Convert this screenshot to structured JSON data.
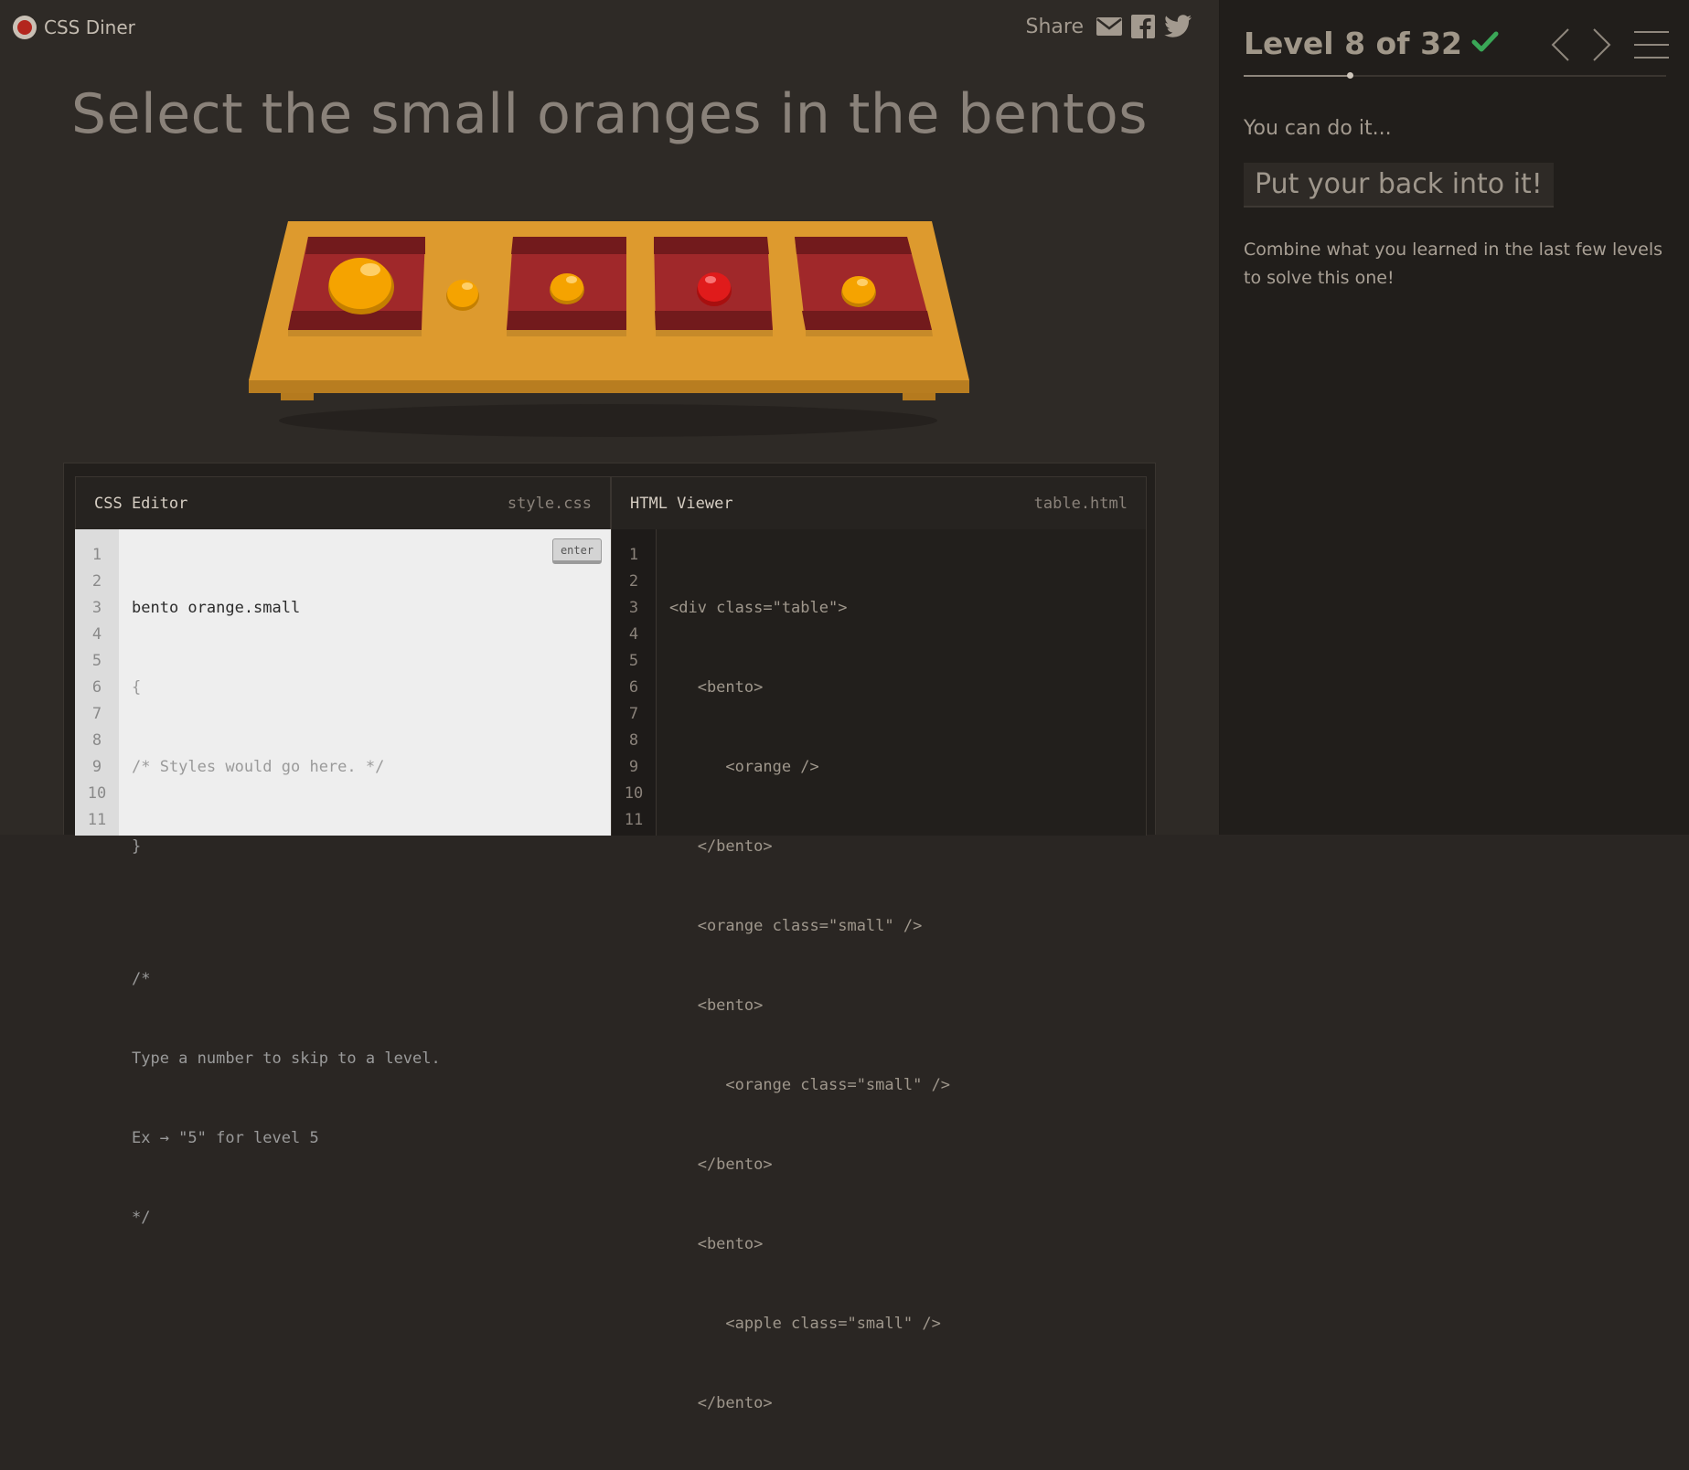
{
  "app": {
    "title": "CSS Diner"
  },
  "share": {
    "label": "Share",
    "icons": [
      "email-icon",
      "facebook-icon",
      "twitter-icon"
    ]
  },
  "instruction": "Select the small oranges in the bentos",
  "table": {
    "items": [
      {
        "type": "bento",
        "contents": [
          {
            "type": "orange",
            "size": "large"
          }
        ]
      },
      {
        "type": "orange",
        "size": "small"
      },
      {
        "type": "bento",
        "contents": [
          {
            "type": "orange",
            "size": "small"
          }
        ]
      },
      {
        "type": "bento",
        "contents": [
          {
            "type": "apple",
            "size": "small"
          }
        ]
      },
      {
        "type": "bento",
        "contents": [
          {
            "type": "orange",
            "size": "small"
          }
        ]
      }
    ]
  },
  "editor": {
    "css_title": "CSS Editor",
    "css_file": "style.css",
    "html_title": "HTML Viewer",
    "html_file": "table.html",
    "enter_label": "enter",
    "input_value": "bento orange.small",
    "line_numbers": [
      "1",
      "2",
      "3",
      "4",
      "5",
      "6",
      "7",
      "8",
      "9",
      "10",
      "11"
    ],
    "css_lines": [
      "{",
      "/* Styles would go here. */",
      "}",
      "",
      "/*",
      "Type a number to skip to a level.",
      "Ex → \"5\" for level 5",
      "*/"
    ],
    "html_lines": [
      "<div class=\"table\">",
      "   <bento>",
      "      <orange />",
      "   </bento>",
      "   <orange class=\"small\" />",
      "   <bento>",
      "      <orange class=\"small\" />",
      "   </bento>",
      "   <bento>",
      "      <apple class=\"small\" />",
      "   </bento>"
    ]
  },
  "sidebar": {
    "level_label": "Level 8 of 32",
    "level_current": 8,
    "level_total": 32,
    "completed": true,
    "hint_title": "You can do it...",
    "hint_box": "Put your back into it!",
    "hint_text": "Combine what you learned in the last few levels to solve this one!"
  },
  "colors": {
    "accent_check": "#3aa757",
    "orange": "#f5a300",
    "apple": "#e01b1b",
    "bento": "#9b2525",
    "table": "#d9962b"
  }
}
